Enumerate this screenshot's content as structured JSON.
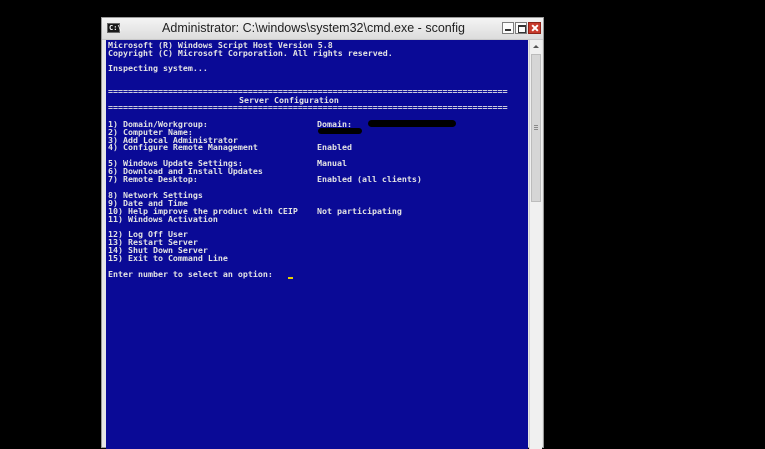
{
  "window": {
    "title": "Administrator: C:\\windows\\system32\\cmd.exe - sconfig",
    "icon_text": "C:\\"
  },
  "console": {
    "header_lines": [
      "Microsoft (R) Windows Script Host Version 5.8",
      "Copyright (C) Microsoft Corporation. All rights reserved."
    ],
    "status": "Inspecting system...",
    "rule": "================================================================================",
    "section_title": "Server Configuration",
    "menu_items": [
      {
        "label": "1) Domain/Workgroup:",
        "value": "Domain:"
      },
      {
        "label": "2) Computer Name:",
        "value": ""
      },
      {
        "label": "3) Add Local Administrator",
        "value": ""
      },
      {
        "label": "4) Configure Remote Management",
        "value": "Enabled"
      },
      {
        "label": "5) Windows Update Settings:",
        "value": "Manual"
      },
      {
        "label": "6) Download and Install Updates",
        "value": ""
      },
      {
        "label": "7) Remote Desktop:",
        "value": "Enabled (all clients)"
      },
      {
        "label": "8) Network Settings",
        "value": ""
      },
      {
        "label": "9) Date and Time",
        "value": ""
      },
      {
        "label": "10) Help improve the product with CEIP",
        "value": "Not participating"
      },
      {
        "label": "11) Windows Activation",
        "value": ""
      },
      {
        "label": "12) Log Off User",
        "value": ""
      },
      {
        "label": "13) Restart Server",
        "value": ""
      },
      {
        "label": "14) Shut Down Server",
        "value": ""
      },
      {
        "label": "15) Exit to Command Line",
        "value": ""
      }
    ],
    "prompt": "Enter number to select an option:"
  },
  "colors": {
    "console_background": "#0a0a96",
    "console_text": "#e4e4e4",
    "cursor": "#e7d000",
    "close_button": "#c7392b"
  }
}
